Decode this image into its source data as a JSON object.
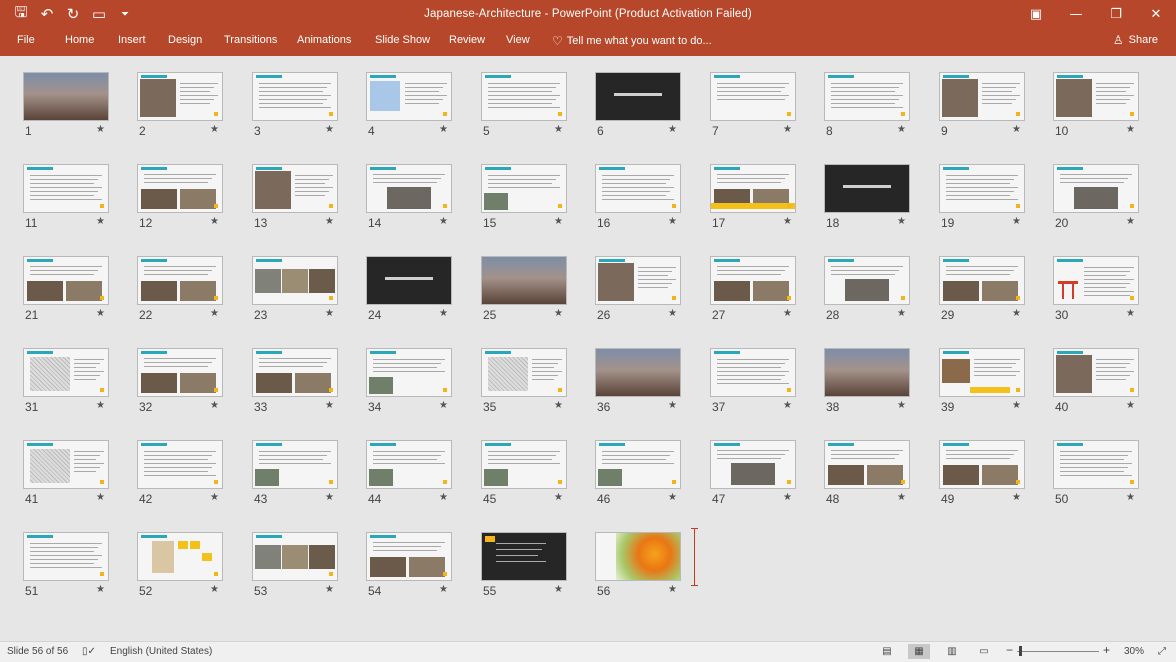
{
  "window": {
    "title": "Japanese-Architecture - PowerPoint (Product Activation Failed)",
    "qat_icons": [
      "save-icon",
      "undo-icon",
      "redo-icon",
      "start-from-beginning-icon",
      "customize-qat-icon"
    ]
  },
  "ribbon": {
    "tabs": [
      "File",
      "Home",
      "Insert",
      "Design",
      "Transitions",
      "Animations",
      "Slide Show",
      "Review",
      "View"
    ],
    "tell_me": "Tell me what you want to do...",
    "share": "Share"
  },
  "slides": [
    {
      "n": "1",
      "t": "photo"
    },
    {
      "n": "2",
      "t": "imgleft"
    },
    {
      "n": "3",
      "t": "text"
    },
    {
      "n": "4",
      "t": "map"
    },
    {
      "n": "5",
      "t": "text"
    },
    {
      "n": "6",
      "t": "dark"
    },
    {
      "n": "7",
      "t": "textlist"
    },
    {
      "n": "8",
      "t": "text"
    },
    {
      "n": "9",
      "t": "imgleft"
    },
    {
      "n": "10",
      "t": "imgleft"
    },
    {
      "n": "11",
      "t": "text"
    },
    {
      "n": "12",
      "t": "twoimg"
    },
    {
      "n": "13",
      "t": "imgleft"
    },
    {
      "n": "14",
      "t": "imgbottom"
    },
    {
      "n": "15",
      "t": "imgsmall"
    },
    {
      "n": "16",
      "t": "text"
    },
    {
      "n": "17",
      "t": "twoimgband"
    },
    {
      "n": "18",
      "t": "dark"
    },
    {
      "n": "19",
      "t": "text"
    },
    {
      "n": "20",
      "t": "imgbottom"
    },
    {
      "n": "21",
      "t": "twoimg"
    },
    {
      "n": "22",
      "t": "twoimg"
    },
    {
      "n": "23",
      "t": "threeimg"
    },
    {
      "n": "24",
      "t": "dark"
    },
    {
      "n": "25",
      "t": "photo"
    },
    {
      "n": "26",
      "t": "imgleft"
    },
    {
      "n": "27",
      "t": "twoimg"
    },
    {
      "n": "28",
      "t": "imgbottom"
    },
    {
      "n": "29",
      "t": "twoimg"
    },
    {
      "n": "30",
      "t": "torii"
    },
    {
      "n": "31",
      "t": "sketch"
    },
    {
      "n": "32",
      "t": "twoimg"
    },
    {
      "n": "33",
      "t": "twoimg"
    },
    {
      "n": "34",
      "t": "imgsmall"
    },
    {
      "n": "35",
      "t": "sketch"
    },
    {
      "n": "36",
      "t": "photo"
    },
    {
      "n": "37",
      "t": "text"
    },
    {
      "n": "38",
      "t": "photo"
    },
    {
      "n": "39",
      "t": "imgband"
    },
    {
      "n": "40",
      "t": "imgleft"
    },
    {
      "n": "41",
      "t": "sketch"
    },
    {
      "n": "42",
      "t": "text"
    },
    {
      "n": "43",
      "t": "imgsmall"
    },
    {
      "n": "44",
      "t": "imgsmall"
    },
    {
      "n": "45",
      "t": "imgsmall"
    },
    {
      "n": "46",
      "t": "imgsmall"
    },
    {
      "n": "47",
      "t": "imgbottom"
    },
    {
      "n": "48",
      "t": "twoimg"
    },
    {
      "n": "49",
      "t": "twoimg"
    },
    {
      "n": "50",
      "t": "text"
    },
    {
      "n": "51",
      "t": "text"
    },
    {
      "n": "52",
      "t": "collage"
    },
    {
      "n": "53",
      "t": "threeimg"
    },
    {
      "n": "54",
      "t": "twoimg"
    },
    {
      "n": "55",
      "t": "darklist"
    },
    {
      "n": "56",
      "t": "flower"
    }
  ],
  "status": {
    "slide_counter": "Slide 56 of 56",
    "language": "English (United States)",
    "zoom": "30%",
    "zoom_minus": "−",
    "zoom_plus": "+"
  },
  "colors": {
    "ribbon": "#b7472a",
    "accent_teal": "#2aa7b8",
    "accent_yellow": "#f3b51a"
  }
}
